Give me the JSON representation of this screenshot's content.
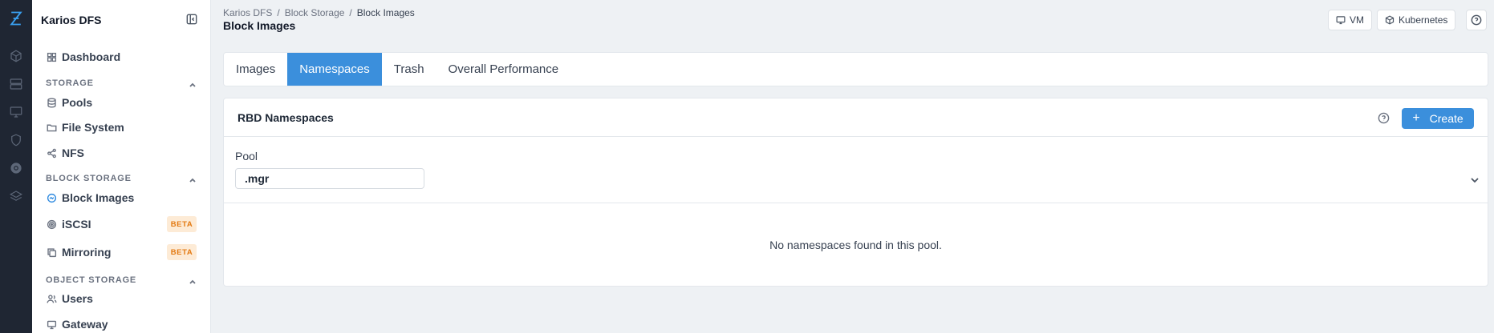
{
  "app": {
    "name": "Karios DFS"
  },
  "rail": {
    "icons": [
      "logo-icon",
      "cube-icon",
      "server-icon",
      "monitor-icon",
      "shield-icon",
      "storage-icon",
      "layers-icon"
    ]
  },
  "sidebar": {
    "items": [
      {
        "label": "Dashboard",
        "icon": "dashboard-icon"
      },
      {
        "label": "Pools",
        "icon": "database-icon"
      },
      {
        "label": "File System",
        "icon": "folder-icon"
      },
      {
        "label": "NFS",
        "icon": "share-icon"
      },
      {
        "label": "Block Images",
        "icon": "block-images-icon",
        "active": true
      },
      {
        "label": "iSCSI",
        "icon": "target-icon"
      },
      {
        "label": "Mirroring",
        "icon": "copy-icon"
      },
      {
        "label": "Users",
        "icon": "users-icon"
      },
      {
        "label": "Gateway",
        "icon": "gateway-icon"
      }
    ],
    "sections": {
      "storage": "STORAGE",
      "block_storage": "BLOCK STORAGE",
      "object_storage": "OBJECT STORAGE"
    },
    "beta_label": "BETA"
  },
  "header": {
    "breadcrumb": [
      "Karios DFS",
      "/",
      "Block Storage",
      "/",
      "Block Images"
    ],
    "title": "Block Images",
    "buttons": {
      "vm": "VM",
      "kubernetes": "Kubernetes"
    }
  },
  "tabs": [
    "Images",
    "Namespaces",
    "Trash",
    "Overall Performance"
  ],
  "active_tab": "Namespaces",
  "panel": {
    "title": "RBD Namespaces",
    "create_label": "Create",
    "pool_label": "Pool",
    "pool_value": ".mgr",
    "empty_message": "No namespaces found in this pool."
  },
  "colors": {
    "accent": "#3b8fdc",
    "rail_bg": "#1f2633",
    "beta_bg": "#fdebd6",
    "beta_text": "#e37a12"
  }
}
